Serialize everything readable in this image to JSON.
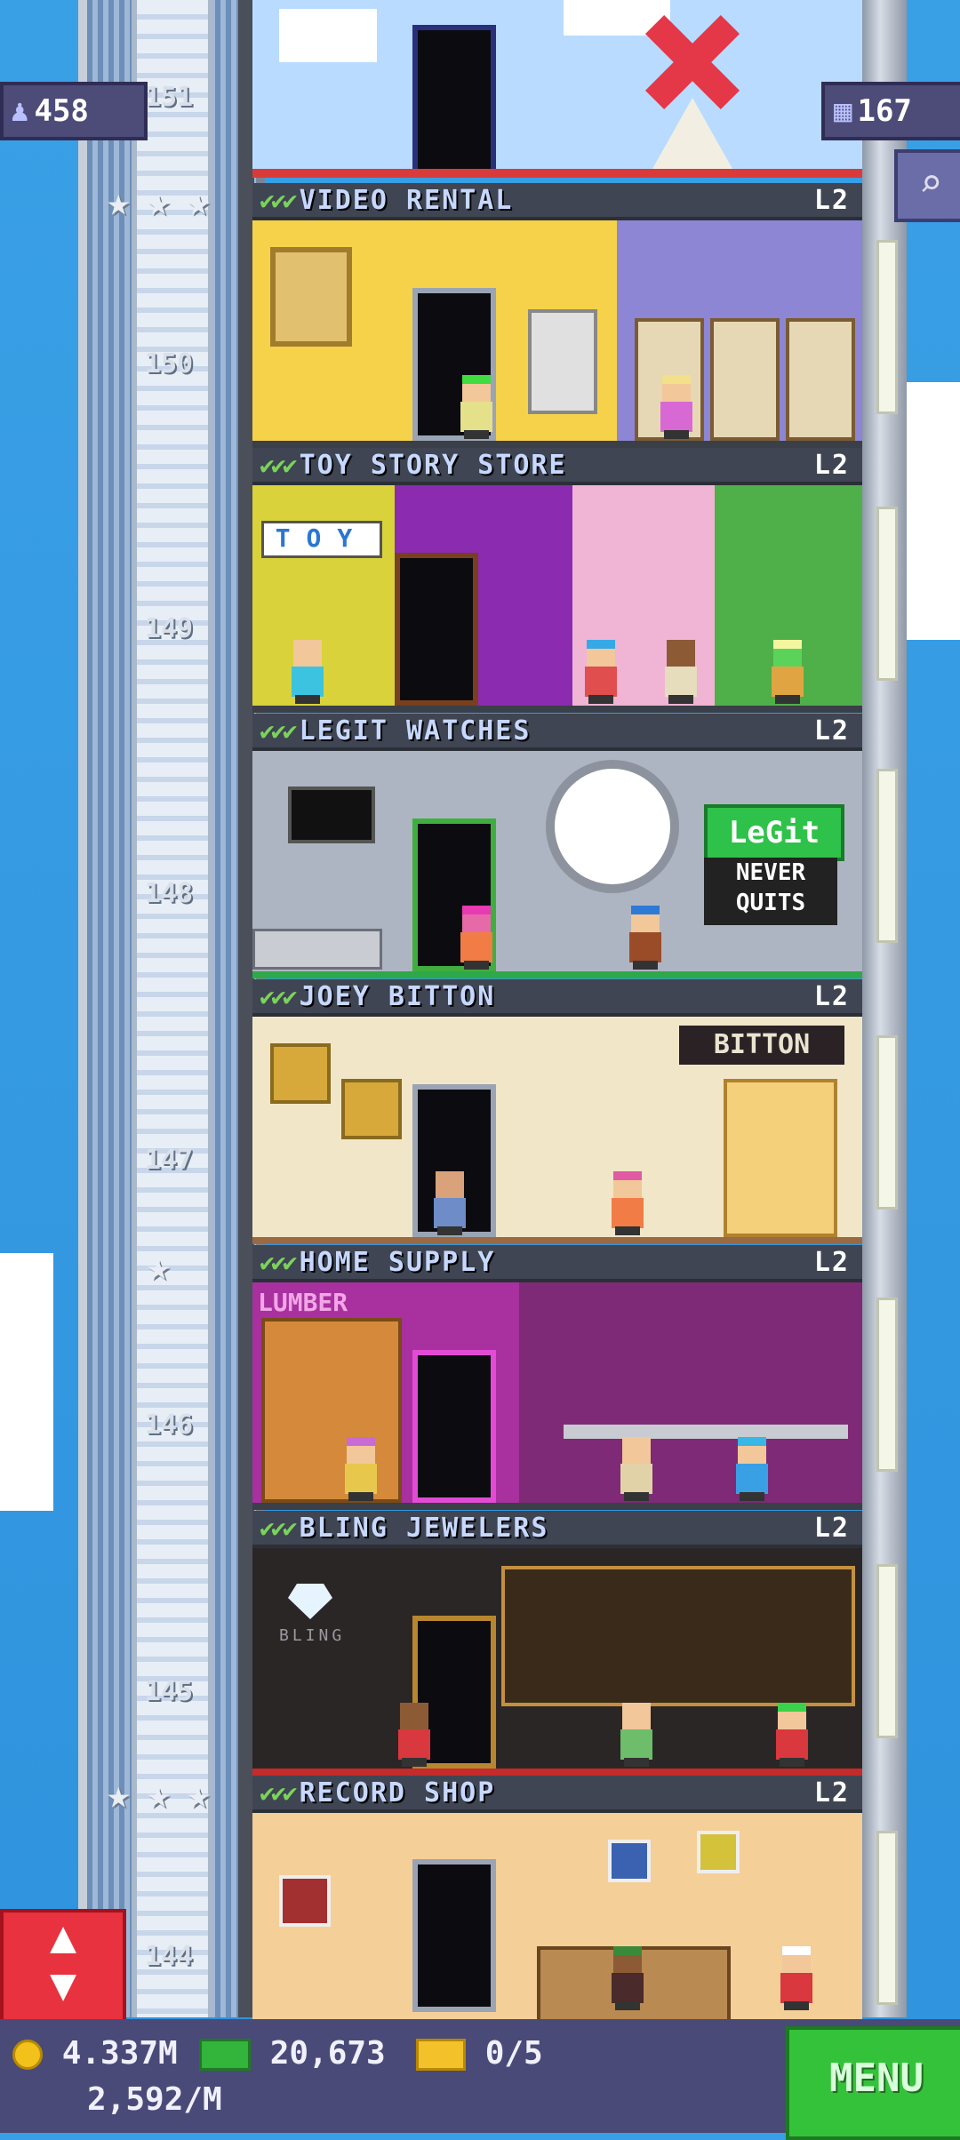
{
  "population": "458",
  "floors_count": "167",
  "search_icon": "magnifier-icon",
  "top_floor": "151",
  "floors": [
    {
      "number": "150",
      "name": "VIDEO RENTAL",
      "level": "L2",
      "color": "#f6d24a",
      "wall2": "#8c86d4"
    },
    {
      "number": "149",
      "name": "TOY STORY STORE",
      "level": "L2",
      "color": "#c23bc7",
      "wall2": "#55b954"
    },
    {
      "number": "148",
      "name": "LEGIT WATCHES",
      "level": "L2",
      "color": "#aeb5c2",
      "wall2": "#aeb5c2"
    },
    {
      "number": "147",
      "name": "JOEY BITTON",
      "level": "L2",
      "color": "#f1e6c8",
      "wall2": "#f1e6c8"
    },
    {
      "number": "146",
      "name": "HOME SUPPLY",
      "level": "L2",
      "color": "#a8309f",
      "wall2": "#7e2a76"
    },
    {
      "number": "145",
      "name": "BLING JEWELERS",
      "level": "L2",
      "color": "#2b2626",
      "wall2": "#3a3228"
    },
    {
      "number": "144",
      "name": "RECORD SHOP",
      "level": "L2",
      "color": "#f5cf98",
      "wall2": "#f5cf98"
    }
  ],
  "signs": {
    "toy_letters": "TOY",
    "legit": "LeGit",
    "never_quits_1": "NEVER",
    "never_quits_2": "QUITS",
    "bitton": "BITTON",
    "lumber": "LUMBER",
    "bling": "BLING"
  },
  "status": {
    "coins": "4.337M",
    "bux": "20,673",
    "tickets": "0/5",
    "income": "2,592/M",
    "menu_label": "MENU"
  }
}
